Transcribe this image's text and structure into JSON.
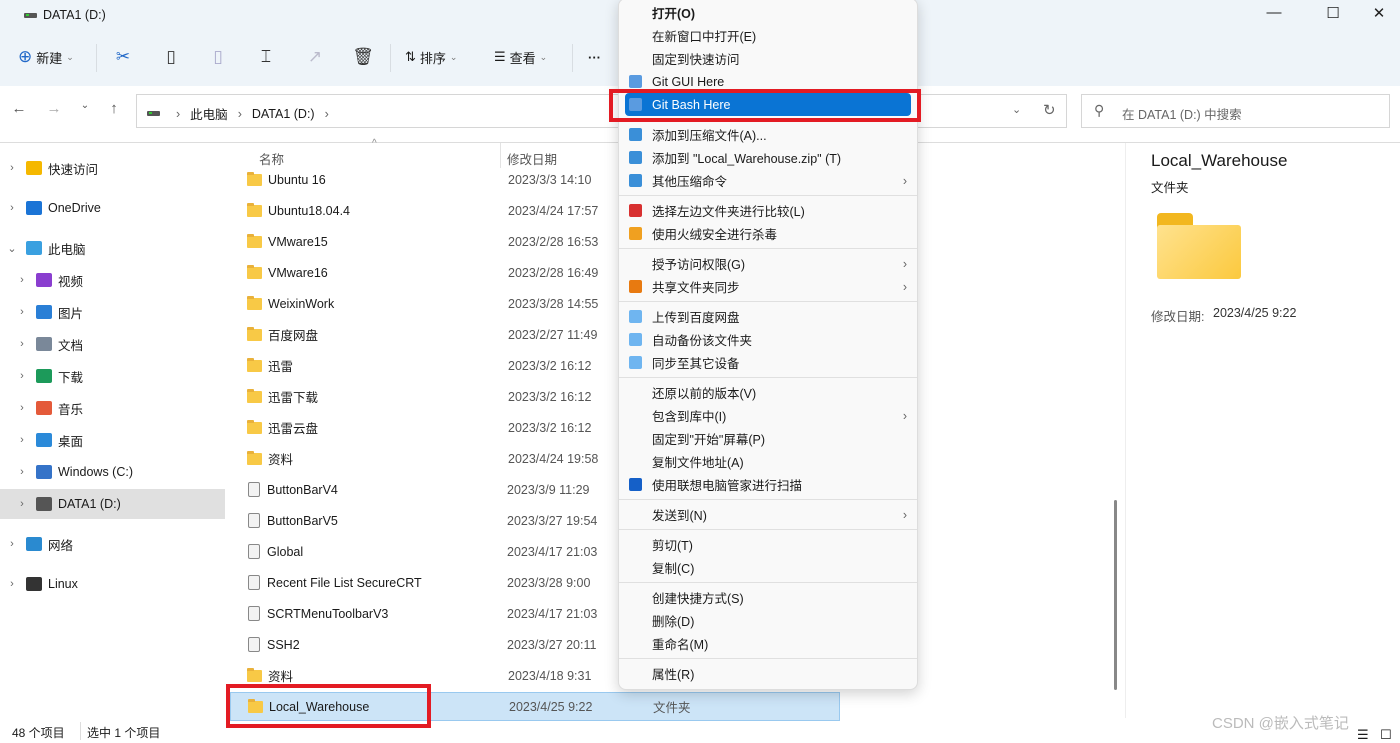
{
  "window": {
    "title": "DATA1 (D:)",
    "controls": [
      "—",
      "☐",
      "✕"
    ]
  },
  "toolbar": {
    "new_label": "新建",
    "sort_label": "排序",
    "view_label": "查看",
    "more": "···"
  },
  "address": {
    "crumbs": [
      "此电脑",
      "DATA1 (D:)"
    ],
    "search_placeholder": "在 DATA1 (D:) 中搜索"
  },
  "nav": [
    {
      "label": "快速访问",
      "color": "#f5b800",
      "expand": true
    },
    {
      "label": "OneDrive",
      "color": "#1b74d6",
      "expand": true
    },
    {
      "label": "此电脑",
      "color": "#3aa0e0",
      "expanded": true
    },
    {
      "label": "视频",
      "color": "#8a3ecf",
      "indent": true
    },
    {
      "label": "图片",
      "color": "#2a7fd6",
      "indent": true
    },
    {
      "label": "文档",
      "color": "#7a8899",
      "indent": true
    },
    {
      "label": "下载",
      "color": "#1c9a5a",
      "indent": true
    },
    {
      "label": "音乐",
      "color": "#e45a3a",
      "indent": true
    },
    {
      "label": "桌面",
      "color": "#2b8ad9",
      "indent": true
    },
    {
      "label": "Windows (C:)",
      "color": "#3573c8",
      "indent": true
    },
    {
      "label": "DATA1 (D:)",
      "color": "#555",
      "indent": true,
      "selected": true
    },
    {
      "label": "网络",
      "color": "#2a8ad0",
      "expand": true
    },
    {
      "label": "Linux",
      "color": "#333",
      "expand": true
    }
  ],
  "columns": {
    "name": "名称",
    "date": "修改日期"
  },
  "files": [
    {
      "name": "Ubuntu 16",
      "date": "2023/3/3 14:10",
      "kind": "folder"
    },
    {
      "name": "Ubuntu18.04.4",
      "date": "2023/4/24 17:57",
      "kind": "folder"
    },
    {
      "name": "VMware15",
      "date": "2023/2/28 16:53",
      "kind": "folder"
    },
    {
      "name": "VMware16",
      "date": "2023/2/28 16:49",
      "kind": "folder"
    },
    {
      "name": "WeixinWork",
      "date": "2023/3/28 14:55",
      "kind": "folder"
    },
    {
      "name": "百度网盘",
      "date": "2023/2/27 11:49",
      "kind": "folder"
    },
    {
      "name": "迅雷",
      "date": "2023/3/2 16:12",
      "kind": "folder"
    },
    {
      "name": "迅雷下载",
      "date": "2023/3/2 16:12",
      "kind": "folder"
    },
    {
      "name": "迅雷云盘",
      "date": "2023/3/2 16:12",
      "kind": "folder"
    },
    {
      "name": "资料",
      "date": "2023/4/24 19:58",
      "kind": "folder"
    },
    {
      "name": "ButtonBarV4",
      "date": "2023/3/9 11:29",
      "kind": "file"
    },
    {
      "name": "ButtonBarV5",
      "date": "2023/3/27 19:54",
      "kind": "file"
    },
    {
      "name": "Global",
      "date": "2023/4/17 21:03",
      "kind": "file"
    },
    {
      "name": "Recent File List SecureCRT",
      "date": "2023/3/28 9:00",
      "kind": "file"
    },
    {
      "name": "SCRTMenuToolbarV3",
      "date": "2023/4/17 21:03",
      "kind": "file"
    },
    {
      "name": "SSH2",
      "date": "2023/3/27 20:11",
      "kind": "file"
    },
    {
      "name": "资料",
      "date": "2023/4/18 9:31",
      "kind": "folder"
    },
    {
      "name": "Local_Warehouse",
      "date": "2023/4/25 9:22",
      "type": "文件夹",
      "kind": "folder",
      "selected": true
    }
  ],
  "context_menu": [
    [
      {
        "label": "打开(O)",
        "bold": true
      },
      {
        "label": "在新窗口中打开(E)"
      },
      {
        "label": "固定到快速访问"
      },
      {
        "label": "Git GUI Here",
        "icon": "#5a9be0"
      },
      {
        "label": "Git Bash Here",
        "icon": "#5a9be0",
        "highlighted": true
      }
    ],
    [
      {
        "label": "添加到压缩文件(A)...",
        "icon": "#3a8fd8"
      },
      {
        "label": "添加到 \"Local_Warehouse.zip\" (T)",
        "icon": "#3a8fd8"
      },
      {
        "label": "其他压缩命令",
        "icon": "#3a8fd8",
        "submenu": true
      }
    ],
    [
      {
        "label": "选择左边文件夹进行比较(L)",
        "icon": "#d83030"
      },
      {
        "label": "使用火绒安全进行杀毒",
        "icon": "#f0a020"
      }
    ],
    [
      {
        "label": "授予访问权限(G)",
        "submenu": true
      },
      {
        "label": "共享文件夹同步",
        "icon": "#e87a10",
        "submenu": true
      }
    ],
    [
      {
        "label": "上传到百度网盘",
        "icon": "#6fb5f0"
      },
      {
        "label": "自动备份该文件夹",
        "icon": "#6fb5f0"
      },
      {
        "label": "同步至其它设备",
        "icon": "#6fb5f0"
      }
    ],
    [
      {
        "label": "还原以前的版本(V)"
      },
      {
        "label": "包含到库中(I)",
        "submenu": true
      },
      {
        "label": "固定到\"开始\"屏幕(P)"
      },
      {
        "label": "复制文件地址(A)"
      },
      {
        "label": "使用联想电脑管家进行扫描",
        "icon": "#1560c8"
      }
    ],
    [
      {
        "label": "发送到(N)",
        "submenu": true
      }
    ],
    [
      {
        "label": "剪切(T)"
      },
      {
        "label": "复制(C)"
      }
    ],
    [
      {
        "label": "创建快捷方式(S)"
      },
      {
        "label": "删除(D)"
      },
      {
        "label": "重命名(M)"
      }
    ],
    [
      {
        "label": "属性(R)"
      }
    ]
  ],
  "details": {
    "name": "Local_Warehouse",
    "type": "文件夹",
    "modified_label": "修改日期:",
    "modified": "2023/4/25 9:22"
  },
  "status": {
    "count": "48 个项目",
    "selected": "选中 1 个项目"
  },
  "watermark": "CSDN @嵌入式笔记",
  "colors": {
    "highlight": "#0a74d4",
    "annotation": "#e31b23",
    "selection": "#cce4f7"
  }
}
